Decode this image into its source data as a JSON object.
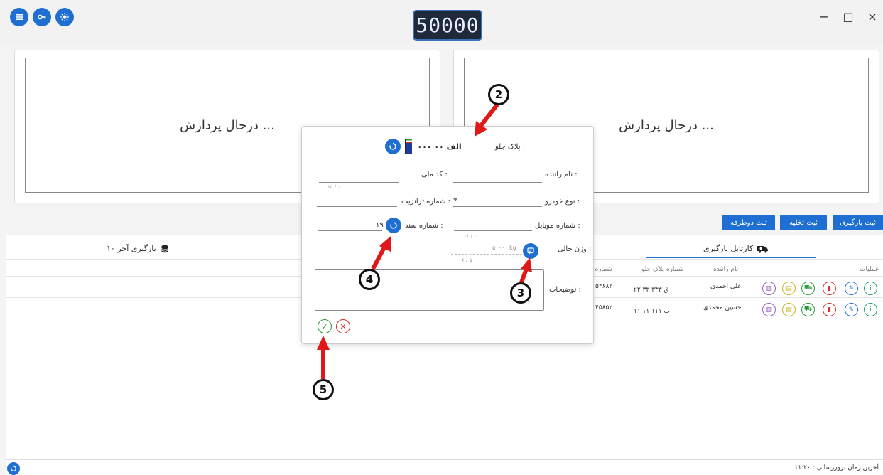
{
  "header": {
    "weight_display": "50000",
    "window_controls": {
      "minimize": "−",
      "maximize": "□",
      "close": "×"
    }
  },
  "camera": {
    "right_status": "درحال پردازش ...",
    "left_status": "درحال پردازش ..."
  },
  "actions": {
    "register_load": "ثبت بارگیری",
    "register_unload": "ثبت تخلیه",
    "register_two_way": "ثبت دوطرفه"
  },
  "tabs": {
    "loading_card": "کارتابل بارگیری",
    "last_loadings": "۱۰ بارگیری آخر"
  },
  "table": {
    "headers": [
      "عملیات",
      "نام راننده",
      "شماره پلاک جلو",
      "شماره ت"
    ],
    "rows": [
      {
        "driver": "علی احمدی",
        "plate": "۲۲ ق ۳۳۳ ۳۳",
        "number": "۵۴۶۸۲"
      },
      {
        "driver": "حسین محمدی",
        "plate": "۱۱ ب ۱۱۱ ۱۱",
        "number": "۴۵۸۵۲"
      }
    ]
  },
  "modal": {
    "front_plate_label": "پلاک جلو :",
    "plate": {
      "digits": "۰۰۰ الف ۰۰",
      "code": "۰۰"
    },
    "driver_name_label": "نام راننده :",
    "national_code_label": "کد ملی :",
    "national_code_counter": "۱۵ / ۰",
    "vehicle_type_label": "نوع خودرو :",
    "transit_number_label": "شماره ترانزیت :",
    "mobile_label": "شماره موبایل :",
    "mobile_counter": "۱۱ / ۰",
    "document_number_label": "شماره سند :",
    "document_number_value": "۱۹",
    "empty_weight_label": "وزن خالی :",
    "empty_weight_value": "۵۰۰۰۰ kg",
    "empty_weight_counter": "۶ / ۵",
    "description_label": "توضیحات :"
  },
  "annotations": [
    "2",
    "3",
    "4",
    "5"
  ],
  "status": {
    "last_update_label": "آخرین زمان بروزرسانی :",
    "last_update_time": "۱۱:۲۰"
  },
  "colors": {
    "primary": "#1e6fd1",
    "weight_bg": "#1e2a3c",
    "arrow": "#e01818"
  }
}
